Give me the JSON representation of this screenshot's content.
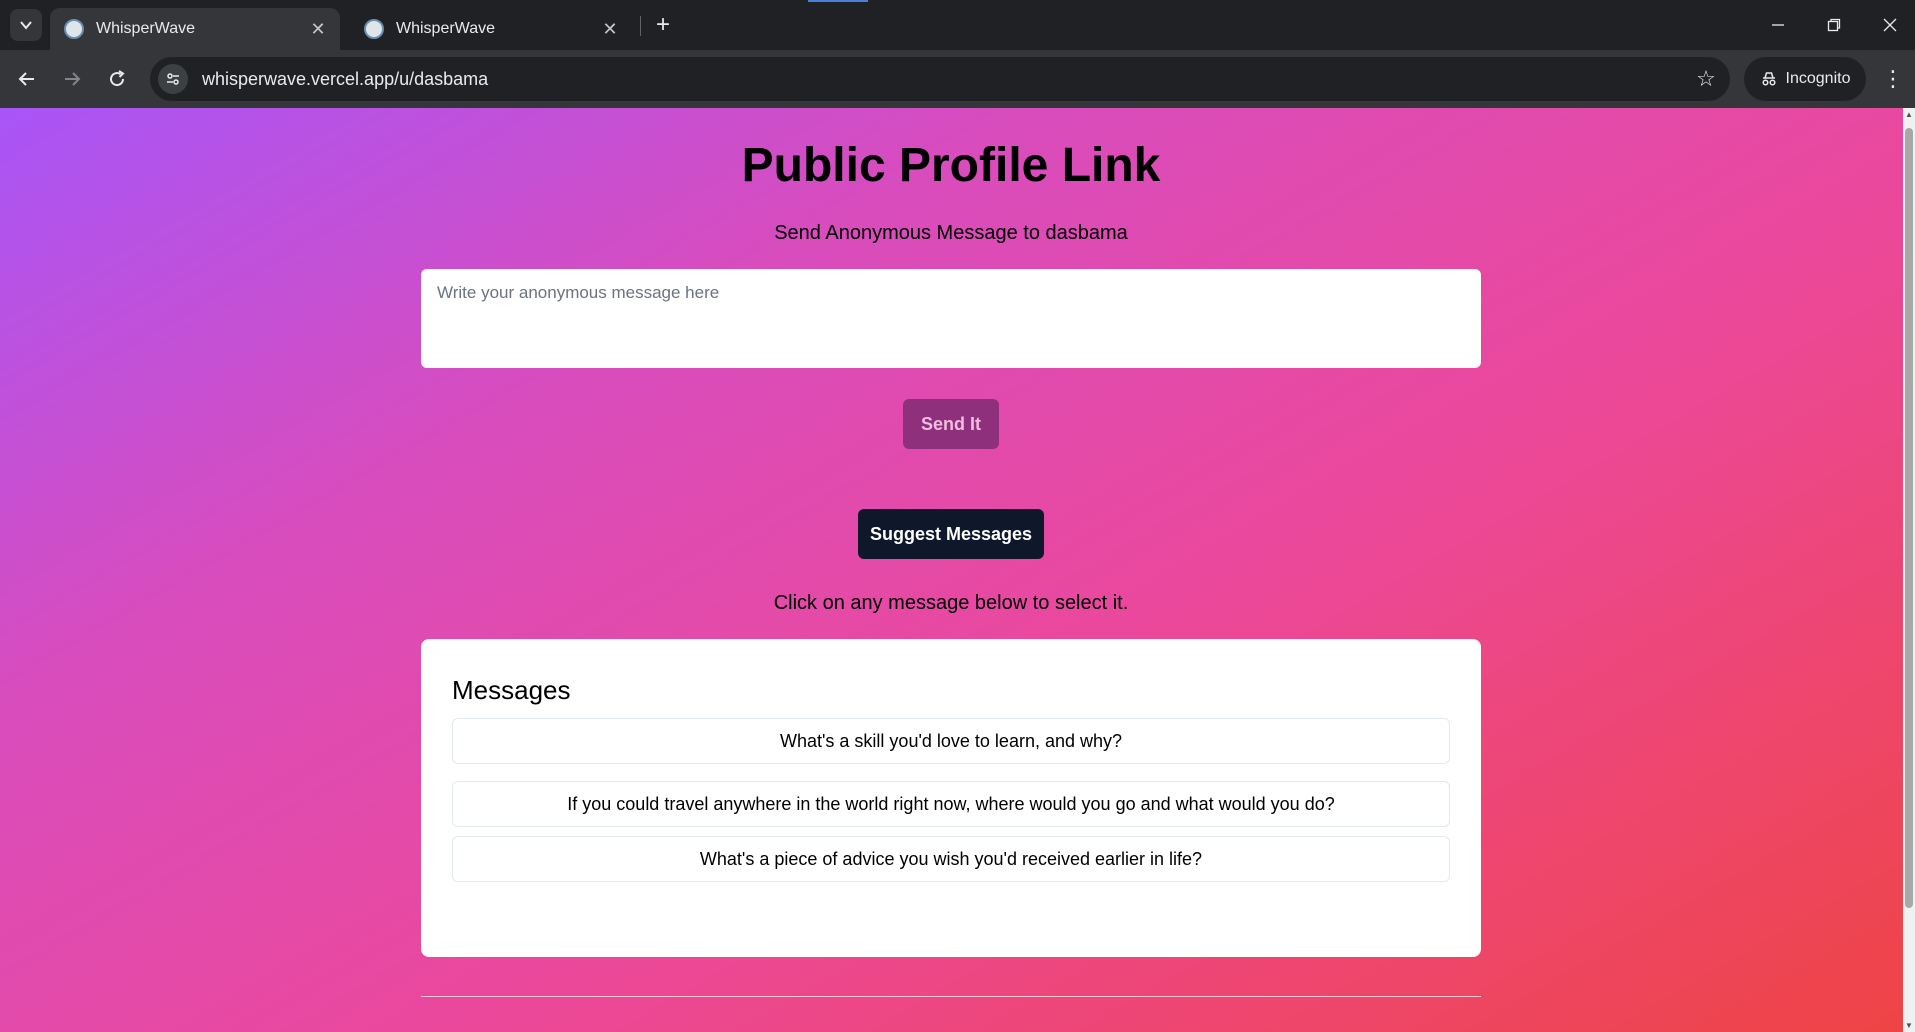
{
  "browser": {
    "tabs": [
      {
        "title": "WhisperWave",
        "active": true
      },
      {
        "title": "WhisperWave",
        "active": false
      }
    ],
    "url": "whisperwave.vercel.app/u/dasbama",
    "incognito_label": "Incognito",
    "icons": {
      "tab_search": "chevron-down-icon",
      "new_tab": "plus-icon",
      "back": "arrow-left-icon",
      "forward": "arrow-right-icon",
      "reload": "reload-icon",
      "site_info": "tune-icon",
      "bookmark": "star-icon",
      "menu": "kebab-icon",
      "incognito": "incognito-icon"
    }
  },
  "page": {
    "title": "Public Profile Link",
    "send_label": "Send Anonymous Message to dasbama",
    "message_input": {
      "placeholder": "Write your anonymous message here",
      "value": ""
    },
    "send_button": "Send It",
    "suggest_button": "Suggest Messages",
    "click_hint": "Click on any message below to select it.",
    "messages_card": {
      "title": "Messages",
      "items": [
        "What's a skill you'd love to learn, and why?",
        "If you could travel anywhere in the world right now, where would you go and what would you do?",
        "What's a piece of advice you wish you'd received earlier in life?"
      ]
    }
  },
  "colors": {
    "gradient_start": "#a855f7",
    "gradient_mid": "#ec4899",
    "gradient_end": "#ef4444",
    "send_button": "#8b2f7a",
    "suggest_button": "#0f172a"
  }
}
